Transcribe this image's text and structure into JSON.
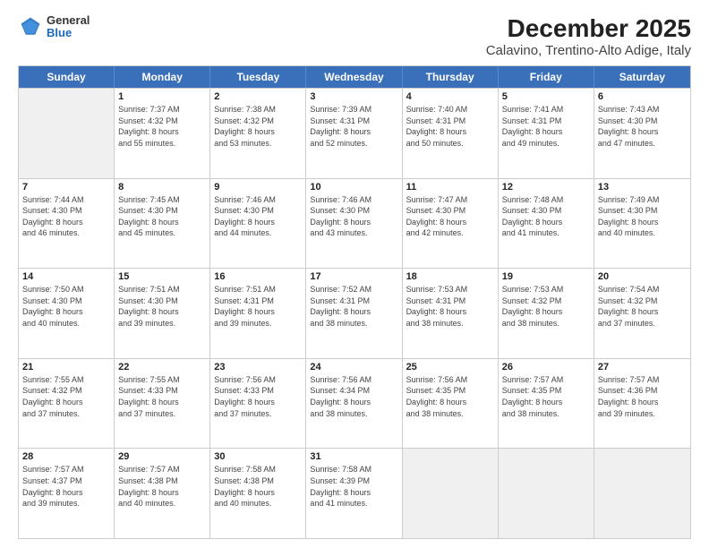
{
  "header": {
    "logo_general": "General",
    "logo_blue": "Blue",
    "title": "December 2025",
    "subtitle": "Calavino, Trentino-Alto Adige, Italy"
  },
  "days_of_week": [
    "Sunday",
    "Monday",
    "Tuesday",
    "Wednesday",
    "Thursday",
    "Friday",
    "Saturday"
  ],
  "rows": [
    [
      {
        "num": "",
        "lines": []
      },
      {
        "num": "1",
        "lines": [
          "Sunrise: 7:37 AM",
          "Sunset: 4:32 PM",
          "Daylight: 8 hours",
          "and 55 minutes."
        ]
      },
      {
        "num": "2",
        "lines": [
          "Sunrise: 7:38 AM",
          "Sunset: 4:32 PM",
          "Daylight: 8 hours",
          "and 53 minutes."
        ]
      },
      {
        "num": "3",
        "lines": [
          "Sunrise: 7:39 AM",
          "Sunset: 4:31 PM",
          "Daylight: 8 hours",
          "and 52 minutes."
        ]
      },
      {
        "num": "4",
        "lines": [
          "Sunrise: 7:40 AM",
          "Sunset: 4:31 PM",
          "Daylight: 8 hours",
          "and 50 minutes."
        ]
      },
      {
        "num": "5",
        "lines": [
          "Sunrise: 7:41 AM",
          "Sunset: 4:31 PM",
          "Daylight: 8 hours",
          "and 49 minutes."
        ]
      },
      {
        "num": "6",
        "lines": [
          "Sunrise: 7:43 AM",
          "Sunset: 4:30 PM",
          "Daylight: 8 hours",
          "and 47 minutes."
        ]
      }
    ],
    [
      {
        "num": "7",
        "lines": [
          "Sunrise: 7:44 AM",
          "Sunset: 4:30 PM",
          "Daylight: 8 hours",
          "and 46 minutes."
        ]
      },
      {
        "num": "8",
        "lines": [
          "Sunrise: 7:45 AM",
          "Sunset: 4:30 PM",
          "Daylight: 8 hours",
          "and 45 minutes."
        ]
      },
      {
        "num": "9",
        "lines": [
          "Sunrise: 7:46 AM",
          "Sunset: 4:30 PM",
          "Daylight: 8 hours",
          "and 44 minutes."
        ]
      },
      {
        "num": "10",
        "lines": [
          "Sunrise: 7:46 AM",
          "Sunset: 4:30 PM",
          "Daylight: 8 hours",
          "and 43 minutes."
        ]
      },
      {
        "num": "11",
        "lines": [
          "Sunrise: 7:47 AM",
          "Sunset: 4:30 PM",
          "Daylight: 8 hours",
          "and 42 minutes."
        ]
      },
      {
        "num": "12",
        "lines": [
          "Sunrise: 7:48 AM",
          "Sunset: 4:30 PM",
          "Daylight: 8 hours",
          "and 41 minutes."
        ]
      },
      {
        "num": "13",
        "lines": [
          "Sunrise: 7:49 AM",
          "Sunset: 4:30 PM",
          "Daylight: 8 hours",
          "and 40 minutes."
        ]
      }
    ],
    [
      {
        "num": "14",
        "lines": [
          "Sunrise: 7:50 AM",
          "Sunset: 4:30 PM",
          "Daylight: 8 hours",
          "and 40 minutes."
        ]
      },
      {
        "num": "15",
        "lines": [
          "Sunrise: 7:51 AM",
          "Sunset: 4:30 PM",
          "Daylight: 8 hours",
          "and 39 minutes."
        ]
      },
      {
        "num": "16",
        "lines": [
          "Sunrise: 7:51 AM",
          "Sunset: 4:31 PM",
          "Daylight: 8 hours",
          "and 39 minutes."
        ]
      },
      {
        "num": "17",
        "lines": [
          "Sunrise: 7:52 AM",
          "Sunset: 4:31 PM",
          "Daylight: 8 hours",
          "and 38 minutes."
        ]
      },
      {
        "num": "18",
        "lines": [
          "Sunrise: 7:53 AM",
          "Sunset: 4:31 PM",
          "Daylight: 8 hours",
          "and 38 minutes."
        ]
      },
      {
        "num": "19",
        "lines": [
          "Sunrise: 7:53 AM",
          "Sunset: 4:32 PM",
          "Daylight: 8 hours",
          "and 38 minutes."
        ]
      },
      {
        "num": "20",
        "lines": [
          "Sunrise: 7:54 AM",
          "Sunset: 4:32 PM",
          "Daylight: 8 hours",
          "and 37 minutes."
        ]
      }
    ],
    [
      {
        "num": "21",
        "lines": [
          "Sunrise: 7:55 AM",
          "Sunset: 4:32 PM",
          "Daylight: 8 hours",
          "and 37 minutes."
        ]
      },
      {
        "num": "22",
        "lines": [
          "Sunrise: 7:55 AM",
          "Sunset: 4:33 PM",
          "Daylight: 8 hours",
          "and 37 minutes."
        ]
      },
      {
        "num": "23",
        "lines": [
          "Sunrise: 7:56 AM",
          "Sunset: 4:33 PM",
          "Daylight: 8 hours",
          "and 37 minutes."
        ]
      },
      {
        "num": "24",
        "lines": [
          "Sunrise: 7:56 AM",
          "Sunset: 4:34 PM",
          "Daylight: 8 hours",
          "and 38 minutes."
        ]
      },
      {
        "num": "25",
        "lines": [
          "Sunrise: 7:56 AM",
          "Sunset: 4:35 PM",
          "Daylight: 8 hours",
          "and 38 minutes."
        ]
      },
      {
        "num": "26",
        "lines": [
          "Sunrise: 7:57 AM",
          "Sunset: 4:35 PM",
          "Daylight: 8 hours",
          "and 38 minutes."
        ]
      },
      {
        "num": "27",
        "lines": [
          "Sunrise: 7:57 AM",
          "Sunset: 4:36 PM",
          "Daylight: 8 hours",
          "and 39 minutes."
        ]
      }
    ],
    [
      {
        "num": "28",
        "lines": [
          "Sunrise: 7:57 AM",
          "Sunset: 4:37 PM",
          "Daylight: 8 hours",
          "and 39 minutes."
        ]
      },
      {
        "num": "29",
        "lines": [
          "Sunrise: 7:57 AM",
          "Sunset: 4:38 PM",
          "Daylight: 8 hours",
          "and 40 minutes."
        ]
      },
      {
        "num": "30",
        "lines": [
          "Sunrise: 7:58 AM",
          "Sunset: 4:38 PM",
          "Daylight: 8 hours",
          "and 40 minutes."
        ]
      },
      {
        "num": "31",
        "lines": [
          "Sunrise: 7:58 AM",
          "Sunset: 4:39 PM",
          "Daylight: 8 hours",
          "and 41 minutes."
        ]
      },
      {
        "num": "",
        "lines": []
      },
      {
        "num": "",
        "lines": []
      },
      {
        "num": "",
        "lines": []
      }
    ]
  ]
}
